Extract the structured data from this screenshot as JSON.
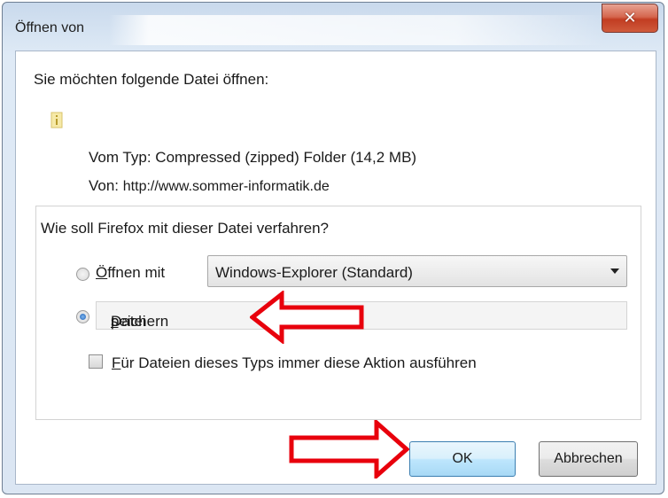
{
  "window": {
    "title": "Öffnen von",
    "close_label": "✕"
  },
  "dialog": {
    "question": "Sie möchten folgende Datei öffnen:",
    "type_label": "Vom Typ:",
    "type_value": "Compressed (zipped) Folder (14,2 MB)",
    "from_label": "Von:",
    "from_value": "http://www.sommer-informatik.de",
    "group_title": "Wie soll Firefox mit dieser Datei verfahren?",
    "open_with_first": "Ö",
    "open_with_rest": "ffnen mit",
    "open_with_app": "Windows-Explorer (Standard)",
    "save_first": "Datei ",
    "save_underlined": "s",
    "save_rest": "peichern",
    "always_first": "F",
    "always_rest": "ür Dateien dieses Typs immer diese Aktion ausführen",
    "open_with_selected": false,
    "save_selected": true,
    "always_checked": false
  },
  "buttons": {
    "ok": "OK",
    "cancel": "Abbrechen"
  },
  "colors": {
    "highlight_arrow": "#e8000c",
    "close_button": "#c84a2e"
  }
}
